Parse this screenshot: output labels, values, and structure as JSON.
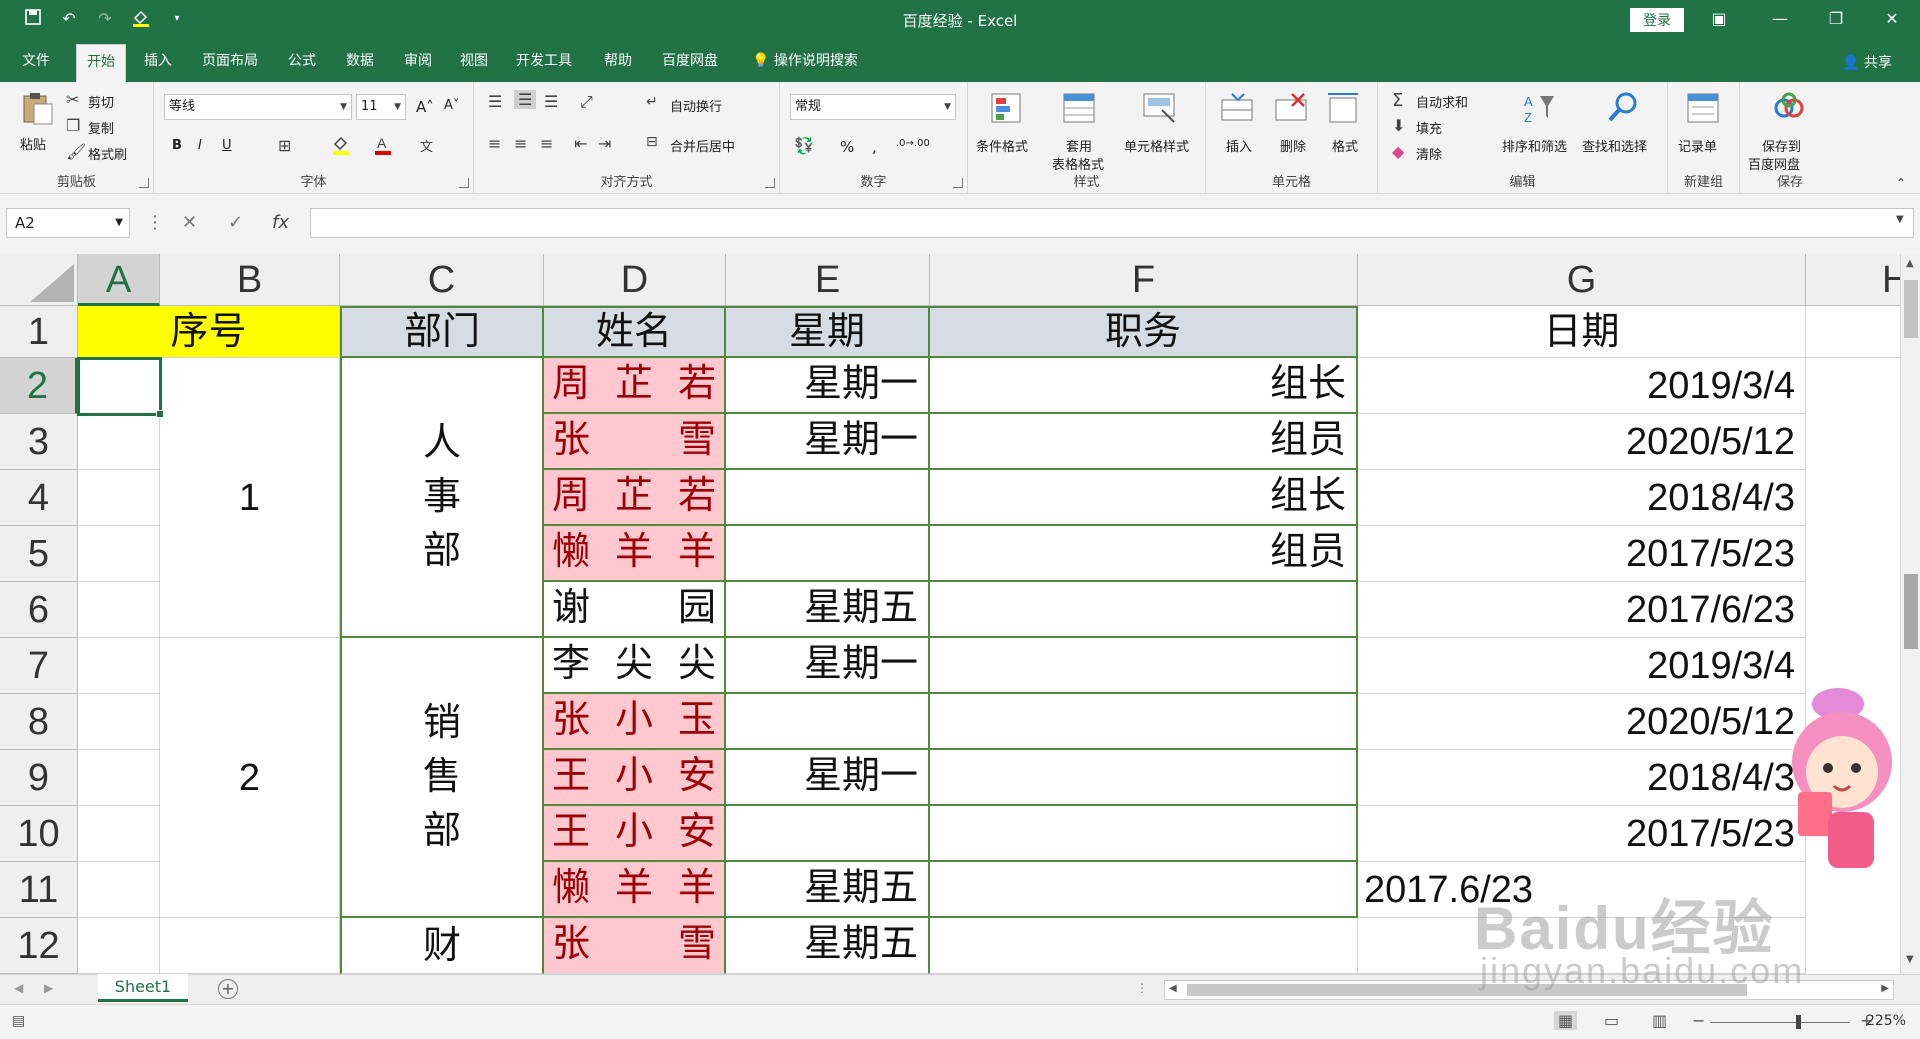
{
  "window": {
    "title": "百度经验 - Excel",
    "login": "登录",
    "minimize": "—",
    "restore": "❐",
    "close": "✕"
  },
  "tabs": [
    "文件",
    "开始",
    "插入",
    "页面布局",
    "公式",
    "数据",
    "审阅",
    "视图",
    "开发工具",
    "帮助",
    "百度网盘",
    "操作说明搜索"
  ],
  "share": "共享",
  "ribbon": {
    "clipboard": {
      "label": "剪贴板",
      "paste": "粘贴",
      "cut": "剪切",
      "copy": "复制",
      "format_painter": "格式刷"
    },
    "font": {
      "label": "字体",
      "name": "等线",
      "size": "11",
      "bold": "B",
      "italic": "I",
      "underline": "U"
    },
    "alignment": {
      "label": "对齐方式",
      "wrap": "自动换行",
      "merge": "合并后居中"
    },
    "number": {
      "label": "数字",
      "format": "常规",
      "percent": "%",
      "comma": ","
    },
    "styles": {
      "label": "样式",
      "conditional": "条件格式",
      "table_line1": "套用",
      "table_line2": "表格格式",
      "cell_styles": "单元格样式"
    },
    "cells": {
      "label": "单元格",
      "insert": "插入",
      "delete": "删除",
      "format": "格式"
    },
    "editing": {
      "label": "编辑",
      "autosum": "自动求和",
      "fill": "填充",
      "clear": "清除",
      "sort": "排序和筛选",
      "find": "查找和选择"
    },
    "newgroup": {
      "label": "新建组",
      "record": "记录单"
    },
    "save": {
      "label": "保存",
      "line1": "保存到",
      "line2": "百度网盘"
    }
  },
  "formula_bar": {
    "namebox": "A2",
    "fx": "fx",
    "cancel": "✕",
    "enter": "✓",
    "content": ""
  },
  "columns": [
    "A",
    "B",
    "C",
    "D",
    "E",
    "F",
    "G",
    "H"
  ],
  "rows": [
    "1",
    "2",
    "3",
    "4",
    "5",
    "6",
    "7",
    "8",
    "9",
    "10",
    "11",
    "12"
  ],
  "header_row": {
    "seq": "序号",
    "dept": "部门",
    "name": "姓名",
    "weekday": "星期",
    "role": "职务",
    "date": "日期"
  },
  "groups": [
    {
      "seq": "1",
      "dept": [
        "人",
        "事",
        "部"
      ]
    },
    {
      "seq": "2",
      "dept": [
        "销",
        "售",
        "部"
      ]
    },
    {
      "seq": "",
      "dept": [
        "财"
      ]
    }
  ],
  "table_rows": [
    {
      "name": [
        "周",
        "芷",
        "若"
      ],
      "weekday": "星期一",
      "role": "组长",
      "date": "2019/3/4"
    },
    {
      "name": [
        "张",
        "雪"
      ],
      "weekday": "星期一",
      "role": "组员",
      "date": "2020/5/12"
    },
    {
      "name": [
        "周",
        "芷",
        "若"
      ],
      "weekday": "",
      "role": "组长",
      "date": "2018/4/3"
    },
    {
      "name": [
        "懒",
        "羊",
        "羊"
      ],
      "weekday": "",
      "role": "组员",
      "date": "2017/5/23"
    },
    {
      "name": [
        "谢",
        "园"
      ],
      "weekday": "星期五",
      "role": "",
      "date": "2017/6/23"
    },
    {
      "name": [
        "李",
        "尖",
        "尖"
      ],
      "weekday": "星期一",
      "role": "",
      "date": "2019/3/4"
    },
    {
      "name": [
        "张",
        "小",
        "玉"
      ],
      "weekday": "",
      "role": "",
      "date": "2020/5/12"
    },
    {
      "name": [
        "王",
        "小",
        "安"
      ],
      "weekday": "星期一",
      "role": "",
      "date": "2018/4/3"
    },
    {
      "name": [
        "王",
        "小",
        "安"
      ],
      "weekday": "",
      "role": "",
      "date": "2017/5/23"
    },
    {
      "name": [
        "懒",
        "羊",
        "羊"
      ],
      "weekday": "星期五",
      "role": "",
      "date": "2017.6/23"
    },
    {
      "name": [
        "张",
        "雪"
      ],
      "weekday": "星期五",
      "role": "",
      "date": ""
    }
  ],
  "sheet_tab": "Sheet1",
  "add_sheet": "+",
  "status": {
    "zoom": "225%"
  },
  "watermark": {
    "logo": "Baidu经验",
    "url": "jingyan.baidu.com"
  },
  "colors": {
    "excel_green": "#217346",
    "header_yellow": "#ffff00",
    "header_blue": "#d6dce4",
    "pink_fill": "#ffc7ce",
    "pink_text": "#9c0006",
    "border_green": "#4e8a3a"
  }
}
